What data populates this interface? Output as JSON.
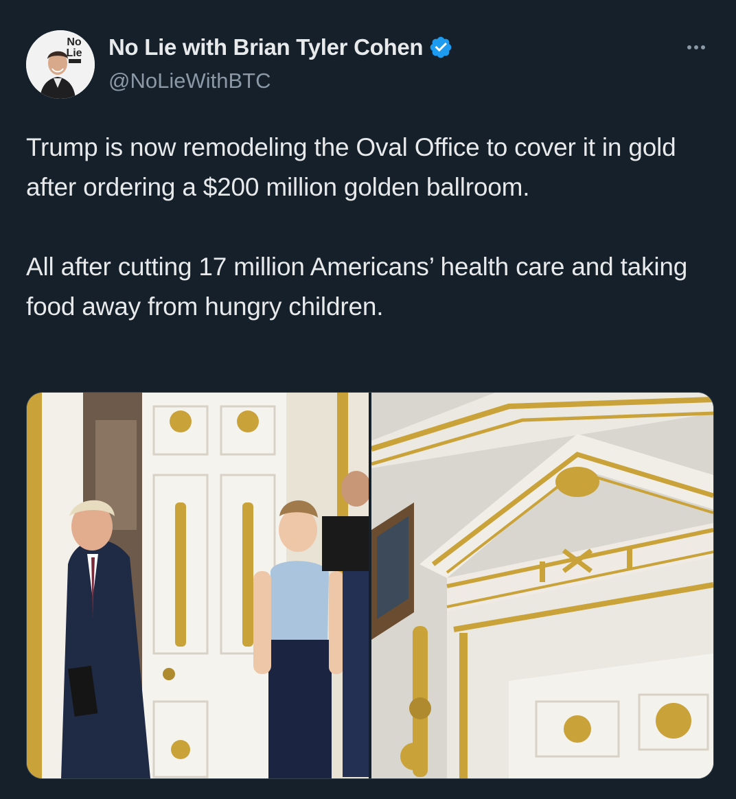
{
  "author": {
    "display_name": "No Lie with Brian Tyler Cohen",
    "handle": "@NoLieWithBTC",
    "verified": true,
    "avatar_logo_text": "No Lie",
    "avatar_logo_small_text": "BTC"
  },
  "tweet": {
    "paragraphs": [
      "Trump is now remodeling the Oval Office to cover it in gold after ordering a $200 million golden ballroom.",
      "All after cutting 17 million Americans’ health care and taking food away from hungry children."
    ]
  },
  "media": {
    "photos": [
      {
        "subject": "door-photo"
      },
      {
        "subject": "gold-molding-photo"
      }
    ]
  },
  "colors": {
    "background": "#15202b",
    "text_primary": "#e7e9ea",
    "text_secondary": "#8b98a5",
    "verified_blue": "#1d9bf0",
    "border": "#38444d",
    "gold": "#c9a23a"
  },
  "icons": {
    "verified": "verified-badge-icon",
    "more": "more-options-icon"
  }
}
